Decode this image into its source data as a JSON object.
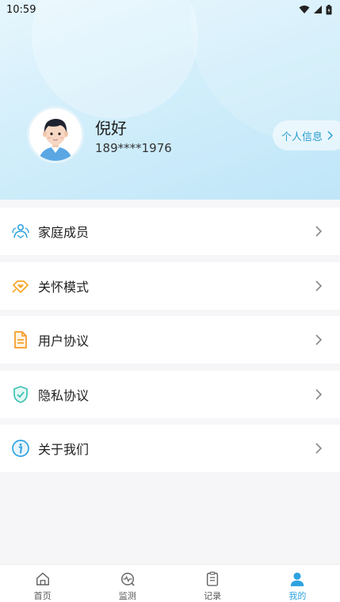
{
  "status_bar": {
    "time": "10:59"
  },
  "profile": {
    "name": "倪好",
    "phone": "189****1976",
    "info_button_label": "个人信息"
  },
  "menu": {
    "items": [
      {
        "label": "家庭成员",
        "icon": "family-members-icon"
      },
      {
        "label": "关怀模式",
        "icon": "care-mode-icon"
      },
      {
        "label": "用户协议",
        "icon": "user-agreement-icon"
      },
      {
        "label": "隐私协议",
        "icon": "privacy-shield-icon"
      },
      {
        "label": "关于我们",
        "icon": "about-info-icon"
      }
    ]
  },
  "tabbar": {
    "tabs": [
      {
        "label": "首页",
        "icon": "home-icon",
        "active": false
      },
      {
        "label": "监测",
        "icon": "monitor-icon",
        "active": false
      },
      {
        "label": "记录",
        "icon": "records-icon",
        "active": false
      },
      {
        "label": "我的",
        "icon": "profile-icon",
        "active": true
      }
    ]
  },
  "colors": {
    "accent": "#2ea3e0",
    "care_orange": "#f5a623",
    "agreement_orange": "#f59a23",
    "privacy_teal": "#3ec3b5"
  }
}
